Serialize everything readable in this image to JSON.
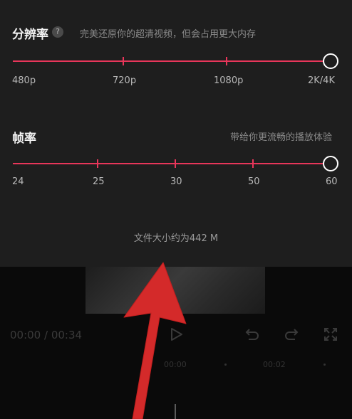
{
  "resolution": {
    "title": "分辨率",
    "help_icon": "?",
    "description": "完美还原你的超清视频，但会占用更大内存",
    "ticks": [
      "480p",
      "720p",
      "1080p",
      "2K/4K"
    ],
    "selected": "2K/4K"
  },
  "framerate": {
    "title": "帧率",
    "description": "带给你更流畅的播放体验",
    "ticks": [
      "24",
      "25",
      "30",
      "50",
      "60"
    ],
    "selected": "60"
  },
  "file_size": "文件大小约为442 M",
  "player": {
    "current_time": "00:00",
    "separator": " / ",
    "total_time": "00:34"
  },
  "timeline": {
    "markers": [
      "00:00",
      "00:02"
    ]
  },
  "colors": {
    "accent": "#e8365a",
    "arrow": "#d42a2a"
  }
}
